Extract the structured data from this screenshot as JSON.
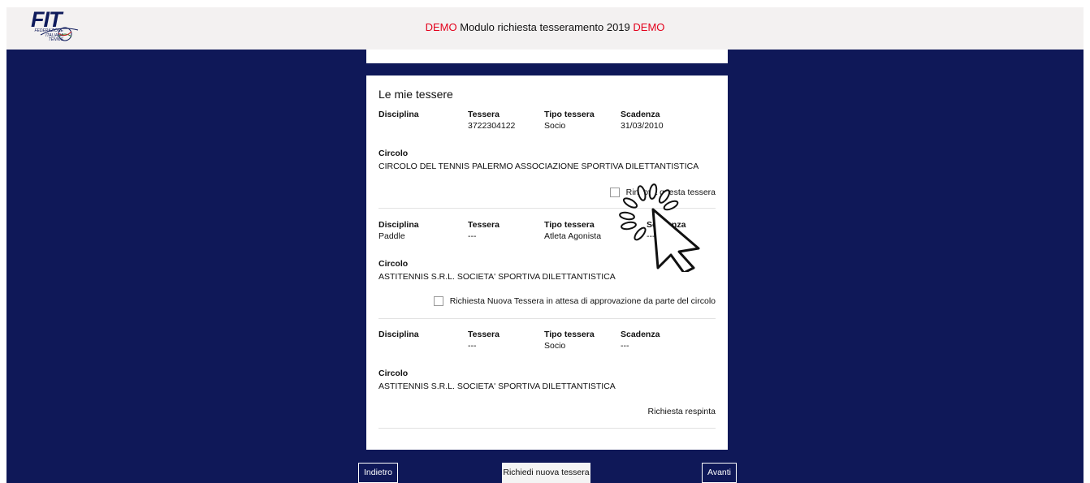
{
  "header": {
    "logo_text": "FIT",
    "logo_sub_1": "FEDERAZIONE",
    "logo_sub_2": "ITALIANA",
    "logo_sub_3": "TENNIS",
    "title_prefix": "DEMO",
    "title_main": " Modulo richiesta tesseramento 2019 ",
    "title_suffix": "DEMO",
    "demo_color": "#e3001b"
  },
  "colors": {
    "background": "#0f1858",
    "header_bg": "#f3f1f1"
  },
  "card": {
    "title": "Le mie tessere",
    "memberships": [
      {
        "disciplina_label": "Disciplina",
        "disciplina": "",
        "tessera_label": "Tessera",
        "tessera": "3722304122",
        "tipo_label": "Tipo tessera",
        "tipo": "Socio",
        "scadenza_label": "Scadenza",
        "scadenza": "31/03/2010",
        "circolo_label": "Circolo",
        "circolo": "CIRCOLO DEL TENNIS PALERMO ASSOCIAZIONE SPORTIVA DILETTANTISTICA",
        "checkbox_label": "Rinnova questa tessera"
      },
      {
        "disciplina_label": "Disciplina",
        "disciplina": "Paddle",
        "tessera_label": "Tessera",
        "tessera": "---",
        "tipo_label": "Tipo tessera",
        "tipo": "Atleta Agonista",
        "scadenza_label": "Scadenza",
        "scadenza": "---",
        "circolo_label": "Circolo",
        "circolo": "ASTITENNIS S.R.L. SOCIETA' SPORTIVA DILETTANTISTICA",
        "checkbox_label": "Richiesta Nuova Tessera in attesa di approvazione da parte del circolo"
      },
      {
        "disciplina_label": "Disciplina",
        "disciplina": "",
        "tessera_label": "Tessera",
        "tessera": "---",
        "tipo_label": "Tipo tessera",
        "tipo": "Socio",
        "scadenza_label": "Scadenza",
        "scadenza": "---",
        "circolo_label": "Circolo",
        "circolo": "ASTITENNIS S.R.L. SOCIETA' SPORTIVA DILETTANTISTICA",
        "status": "Richiesta respinta"
      }
    ]
  },
  "footer": {
    "back_label": "Indietro",
    "new_label": "Richiedi nuova tessera",
    "next_label": "Avanti"
  },
  "overlay": {
    "icon": "click-cursor-icon"
  }
}
